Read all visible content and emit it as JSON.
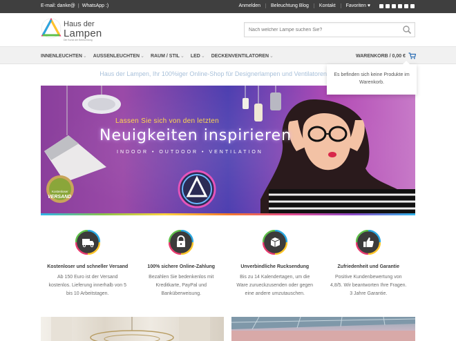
{
  "topbar": {
    "email": "E-mail: danke@",
    "separator": "|",
    "whatsapp": "WhatsApp :)",
    "links": [
      "Anmelden",
      "Beleuchtung Blog",
      "Kontakt",
      "Favoriten"
    ]
  },
  "logo": {
    "line1": "Haus der",
    "line2": "Lampen",
    "tagline": "Die Kunst der Beleuchtung"
  },
  "search": {
    "placeholder": "Nach welcher Lampe suchen Sie?"
  },
  "nav": {
    "items": [
      {
        "label": "INNENLEUCHTEN"
      },
      {
        "label": "AUSSENLEUCHTEN"
      },
      {
        "label": "RAUM / STIL"
      },
      {
        "label": "LED"
      },
      {
        "label": "DECKENVENTILATOREN"
      }
    ],
    "cart_label": "WARENKORB / 0,00 €"
  },
  "cart_dropdown": {
    "message": "Es befinden sich keine Produkte im Warenkorb."
  },
  "intro": "Haus der Lampen, Ihr 100%iger Online-Shop für Designerlampen und Ventilatoren",
  "hero": {
    "headline_top": "Lassen Sie sich von den letzten",
    "headline_main": "Neuigkeiten inspirieren",
    "sub": "INDOOR • OUTDOOR • VENTILATION",
    "badge_line1": "Kostenloser",
    "badge_line2": "VERSAND"
  },
  "features": [
    {
      "icon": "truck-icon",
      "title": "Kostenloser und schneller Versand",
      "text": "Ab 150 Euro ist der Versand kostenlos. Lieferung innerhalb von 5 bis 10 Arbeitstagen."
    },
    {
      "icon": "lock-icon",
      "title": "100% sichere Online-Zahlung",
      "text": "Bezahlen Sie bedenkenlos mit Kreditkarte, PayPal und Banküberweisung."
    },
    {
      "icon": "return-box-icon",
      "title": "Unverbindliche Rucksendung",
      "text": "Bis zu 14 Kalendertagen, um die Ware zurueckzusenden oder gegen eine andere umzutauschen."
    },
    {
      "icon": "thumbs-up-icon",
      "title": "Zufriedenheit und Garantie",
      "text": "Positive Kundenbewertung von 4,8/5. Wir beantworten Ihre Fragen. 3 Jahre Garantie."
    }
  ],
  "colors": {
    "topbar_bg": "#3f3f3f",
    "nav_bg": "#f1f1f1",
    "intro_text": "#a9c1da",
    "hero_purple": "#8a3f9c"
  }
}
